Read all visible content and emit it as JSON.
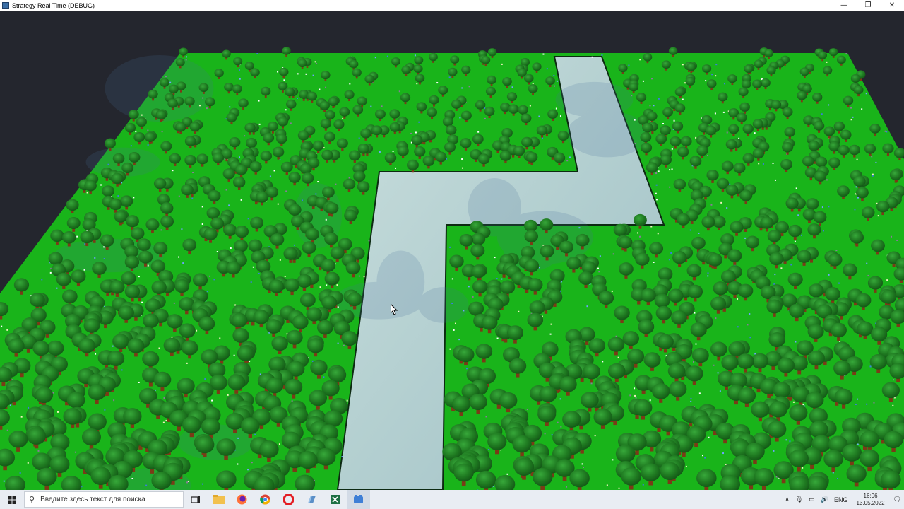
{
  "window": {
    "title": "Strategy Real Time (DEBUG)",
    "controls": [
      "—",
      "❐",
      "✕"
    ]
  },
  "scene": {
    "grass_color": "#19b41a",
    "water_color": "#b8d4d2",
    "tree_color": "#1f7a21",
    "trunk_color": "#7a3b17",
    "background_color": "#24262e"
  },
  "taskbar": {
    "search_placeholder": "Введите здесь текст для поиска",
    "language": "ENG",
    "time": "16:06",
    "date": "13.05.2022"
  }
}
